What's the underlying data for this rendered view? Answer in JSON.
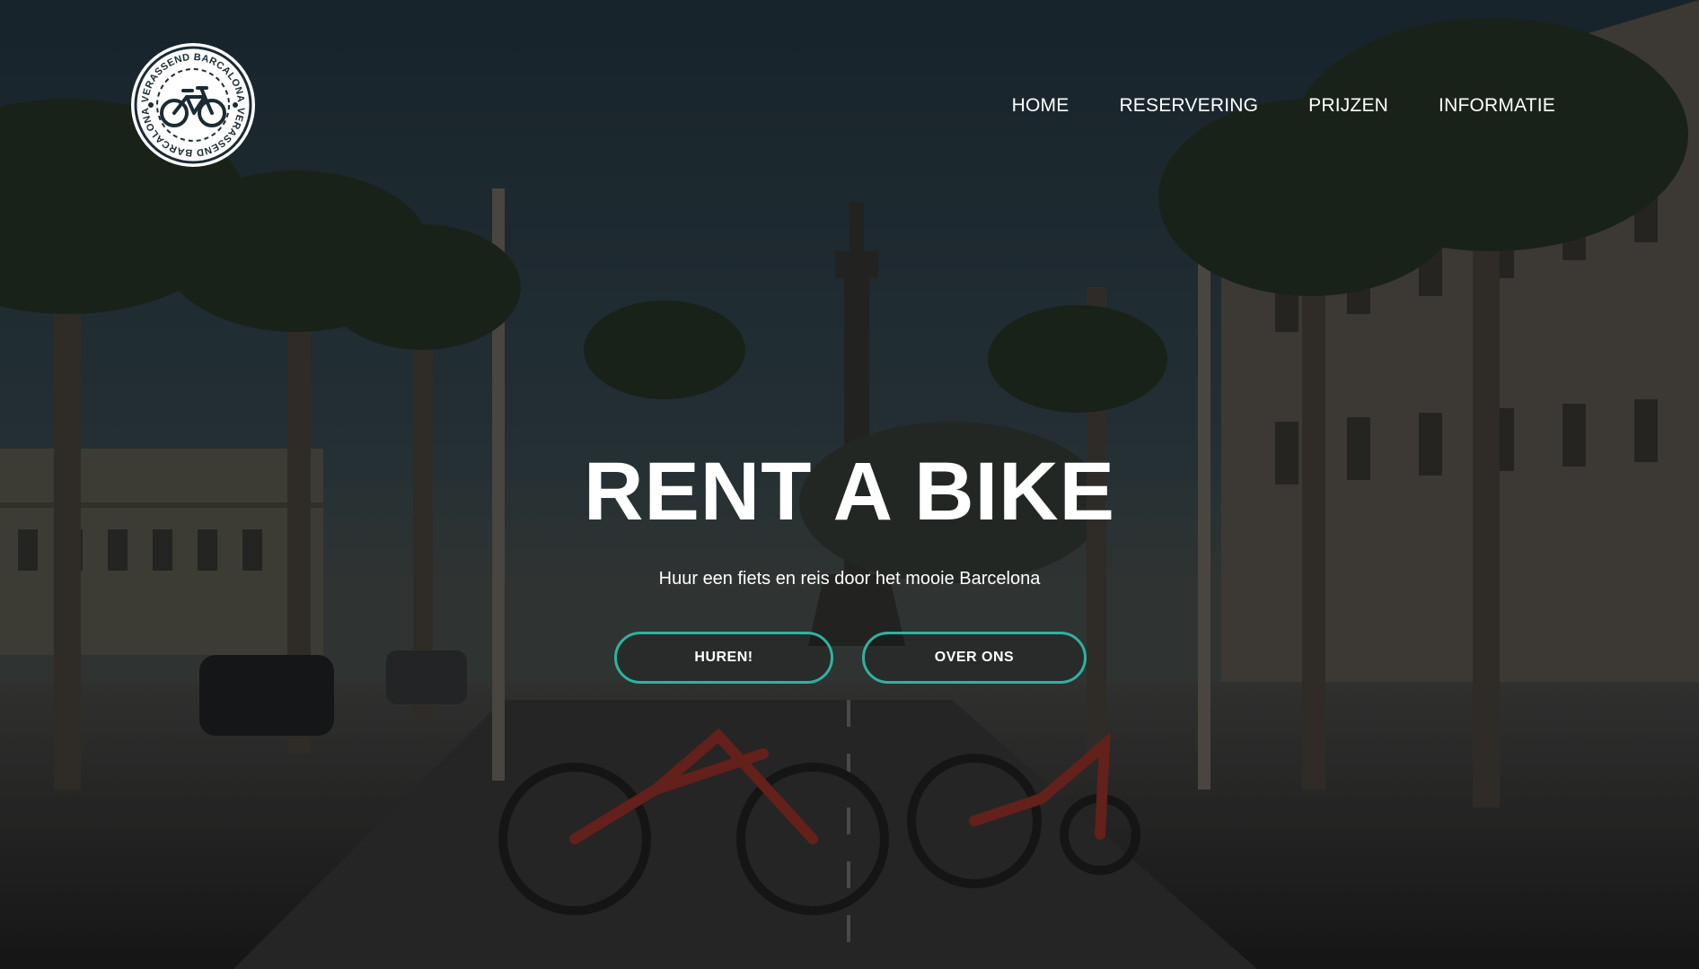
{
  "logo": {
    "top_text": "VERASSEND BARCALONA",
    "bottom_text": "VERASSEND BARCALONA"
  },
  "nav": {
    "items": [
      {
        "label": "HOME"
      },
      {
        "label": "RESERVERING"
      },
      {
        "label": "PRIJZEN"
      },
      {
        "label": "INFORMATIE"
      }
    ]
  },
  "hero": {
    "title": "RENT A BIKE",
    "subtitle": "Huur een fiets en reis door het mooie Barcelona",
    "buttons": {
      "primary_label": "HUREN!",
      "secondary_label": "OVER ONS"
    }
  },
  "colors": {
    "accent": "#2fb29f",
    "text": "#ffffff"
  },
  "icons": [
    "bicycle-icon"
  ]
}
